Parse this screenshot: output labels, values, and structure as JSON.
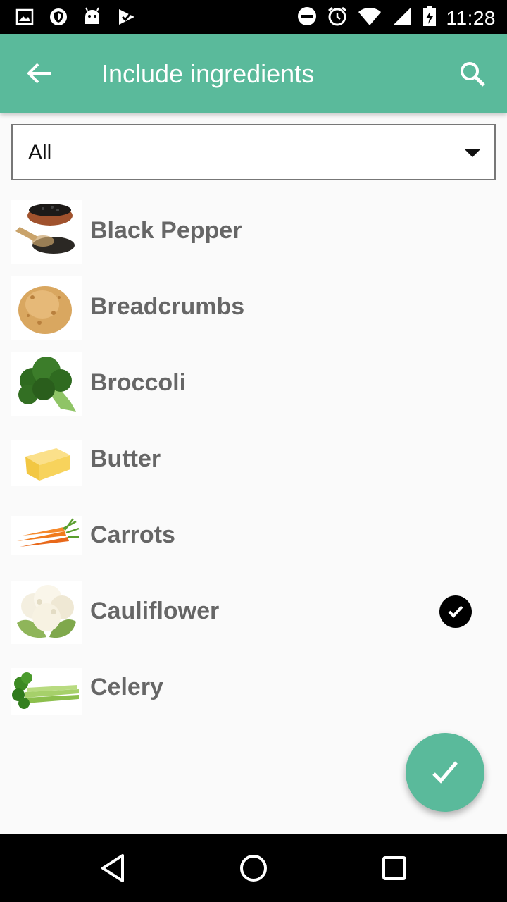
{
  "status_bar": {
    "time": "11:28",
    "icons": [
      "image-icon",
      "shield-icon",
      "android-icon",
      "checkmark-app-icon",
      "dnd-icon",
      "alarm-icon",
      "wifi-icon",
      "signal-icon",
      "battery-charging-icon"
    ]
  },
  "app_bar": {
    "title": "Include ingredients",
    "back_icon": "arrow-back-icon",
    "search_icon": "search-icon",
    "color": "#5aba9b"
  },
  "filter": {
    "selected": "All"
  },
  "ingredients": [
    {
      "name": "Black Pepper",
      "checked": false
    },
    {
      "name": "Breadcrumbs",
      "checked": false
    },
    {
      "name": "Broccoli",
      "checked": false
    },
    {
      "name": "Butter",
      "checked": false
    },
    {
      "name": "Carrots",
      "checked": false
    },
    {
      "name": "Cauliflower",
      "checked": true
    },
    {
      "name": "Celery",
      "checked": false
    }
  ],
  "fab": {
    "icon": "check-icon"
  },
  "nav_bar": {
    "icons": [
      "back-triangle-icon",
      "home-circle-icon",
      "recents-square-icon"
    ]
  }
}
